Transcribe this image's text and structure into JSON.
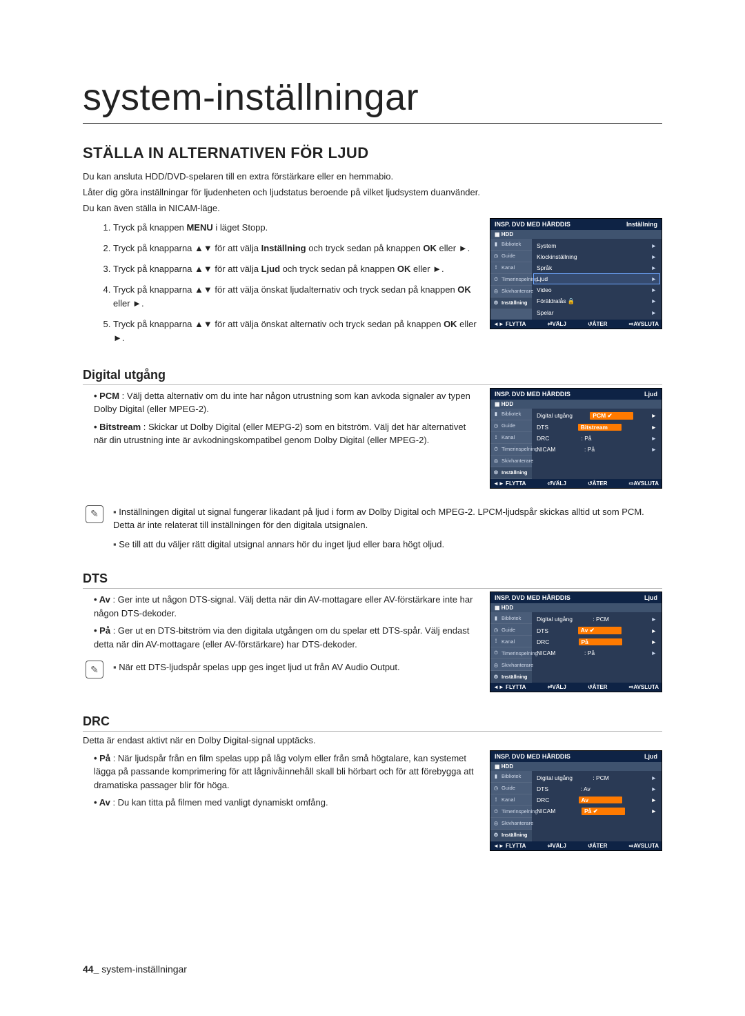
{
  "page": {
    "title": "system-inställningar",
    "footer_num": "44_",
    "footer_text": "system-inställningar"
  },
  "section": {
    "heading": "STÄLLA IN ALTERNATIVEN FÖR LJUD",
    "intro1": "Du kan ansluta HDD/DVD-spelaren till en extra förstärkare eller en hemmabio.",
    "intro2": "Låter dig göra inställningar för ljudenheten och ljudstatus beroende på vilket ljudsystem duanvänder.",
    "intro3": "Du kan även ställa in NICAM-läge."
  },
  "steps": {
    "s1a": "Tryck på knappen ",
    "s1b": "MENU",
    "s1c": " i läget Stopp.",
    "s2a": "Tryck på knapparna ▲▼ för att välja ",
    "s2b": "Inställning",
    "s2c": " och tryck sedan på knappen ",
    "s2d": "OK",
    "s2e": " eller ►.",
    "s3a": "Tryck på knapparna ▲▼ för att välja ",
    "s3b": "Ljud",
    "s3c": " och tryck sedan på knappen ",
    "s3d": "OK",
    "s3e": " eller ►.",
    "s4a": "Tryck på knapparna ▲▼ för att välja önskat ljudalternativ och tryck sedan på knappen ",
    "s4b": "OK",
    "s4c": " eller ►.",
    "s5a": "Tryck på knapparna ▲▼ för att välja önskat alternativ och tryck sedan på knappen ",
    "s5b": "OK",
    "s5c": " eller ►."
  },
  "digital": {
    "heading": "Digital utgång",
    "pcm_label": "PCM",
    "pcm_text": " : Välj detta alternativ om du inte har någon utrustning som kan avkoda signaler av typen Dolby Digital (eller MPEG-2).",
    "bit_label": "Bitstream",
    "bit_text": " : Skickar ut Dolby Digital (eller MEPG-2) som en bitström. Välj det här alternativet när din utrustning inte är avkodningskompatibel genom Dolby Digital (eller MPEG-2).",
    "note1": "Inställningen digital ut signal fungerar likadant på ljud i form av Dolby Digital och MPEG-2. LPCM-ljudspår skickas alltid ut som PCM. Detta är inte relaterat till inställningen för den digitala utsignalen.",
    "note2": "Se till att du väljer rätt digital utsignal annars hör du inget ljud eller bara högt oljud."
  },
  "dts": {
    "heading": "DTS",
    "av_label": "Av",
    "av_text": " : Ger inte ut någon DTS-signal. Välj detta när din AV-mottagare eller AV-förstärkare inte har någon DTS-dekoder.",
    "pa_label": "På",
    "pa_text": " : Ger ut en DTS-bitström via den digitala utgången om du spelar ett DTS-spår. Välj endast detta när din AV-mottagare (eller AV-förstärkare) har DTS-dekoder.",
    "note": "När ett DTS-ljudspår spelas upp ges inget ljud ut från AV Audio Output."
  },
  "drc": {
    "heading": "DRC",
    "intro": "Detta är endast aktivt när en Dolby Digital-signal upptäcks.",
    "pa_label": "På",
    "pa_text": " : När ljudspår från en film spelas upp på låg volym eller från små högtalare, kan systemet lägga på passande komprimering för att lågnivåinnehåll skall bli hörbart och för att förebygga att dramatiska passager blir för höga.",
    "av_label": "Av",
    "av_text": " : Du kan titta på filmen med vanligt dynamiskt omfång."
  },
  "osd": {
    "device": "INSP. DVD MED HÅRDDIS",
    "hdd": "HDD",
    "side": {
      "bibliotek": "Bibliotek",
      "guide": "Guide",
      "kanal": "Kanal",
      "timer": "Timerinspelning",
      "skivhant": "Skivhanterare",
      "install": "Inställning"
    },
    "footer": {
      "flytta": "◄► FLYTTA",
      "valj": "VÄLJ",
      "ater": "↺ÅTER",
      "avsluta": "AVSLUTA"
    },
    "menu1": {
      "context": "Inställning",
      "items": [
        "System",
        "Klockinställning",
        "Språk",
        "Ljud",
        "Video",
        "Föräldralås",
        "Spelar"
      ]
    },
    "menu2": {
      "context": "Ljud",
      "rows": [
        {
          "k": "Digital utgång",
          "v": "PCM",
          "hl": true,
          "check": true
        },
        {
          "k": "DTS",
          "v": "Bitstream",
          "hl": true
        },
        {
          "k": "DRC",
          "v": ": På"
        },
        {
          "k": "NICAM",
          "v": ": På"
        }
      ]
    },
    "menu3": {
      "context": "Ljud",
      "rows": [
        {
          "k": "Digital utgång",
          "v": ": PCM"
        },
        {
          "k": "DTS",
          "v": "Av",
          "hl": true,
          "check": true
        },
        {
          "k": "DRC",
          "v": "På",
          "hl": true
        },
        {
          "k": "NICAM",
          "v": ": På"
        }
      ]
    },
    "menu4": {
      "context": "Ljud",
      "rows": [
        {
          "k": "Digital utgång",
          "v": ": PCM"
        },
        {
          "k": "DTS",
          "v": ": Av"
        },
        {
          "k": "DRC",
          "v": "Av",
          "hl": true
        },
        {
          "k": "NICAM",
          "v": "På",
          "hl": true,
          "check": true
        }
      ]
    }
  }
}
